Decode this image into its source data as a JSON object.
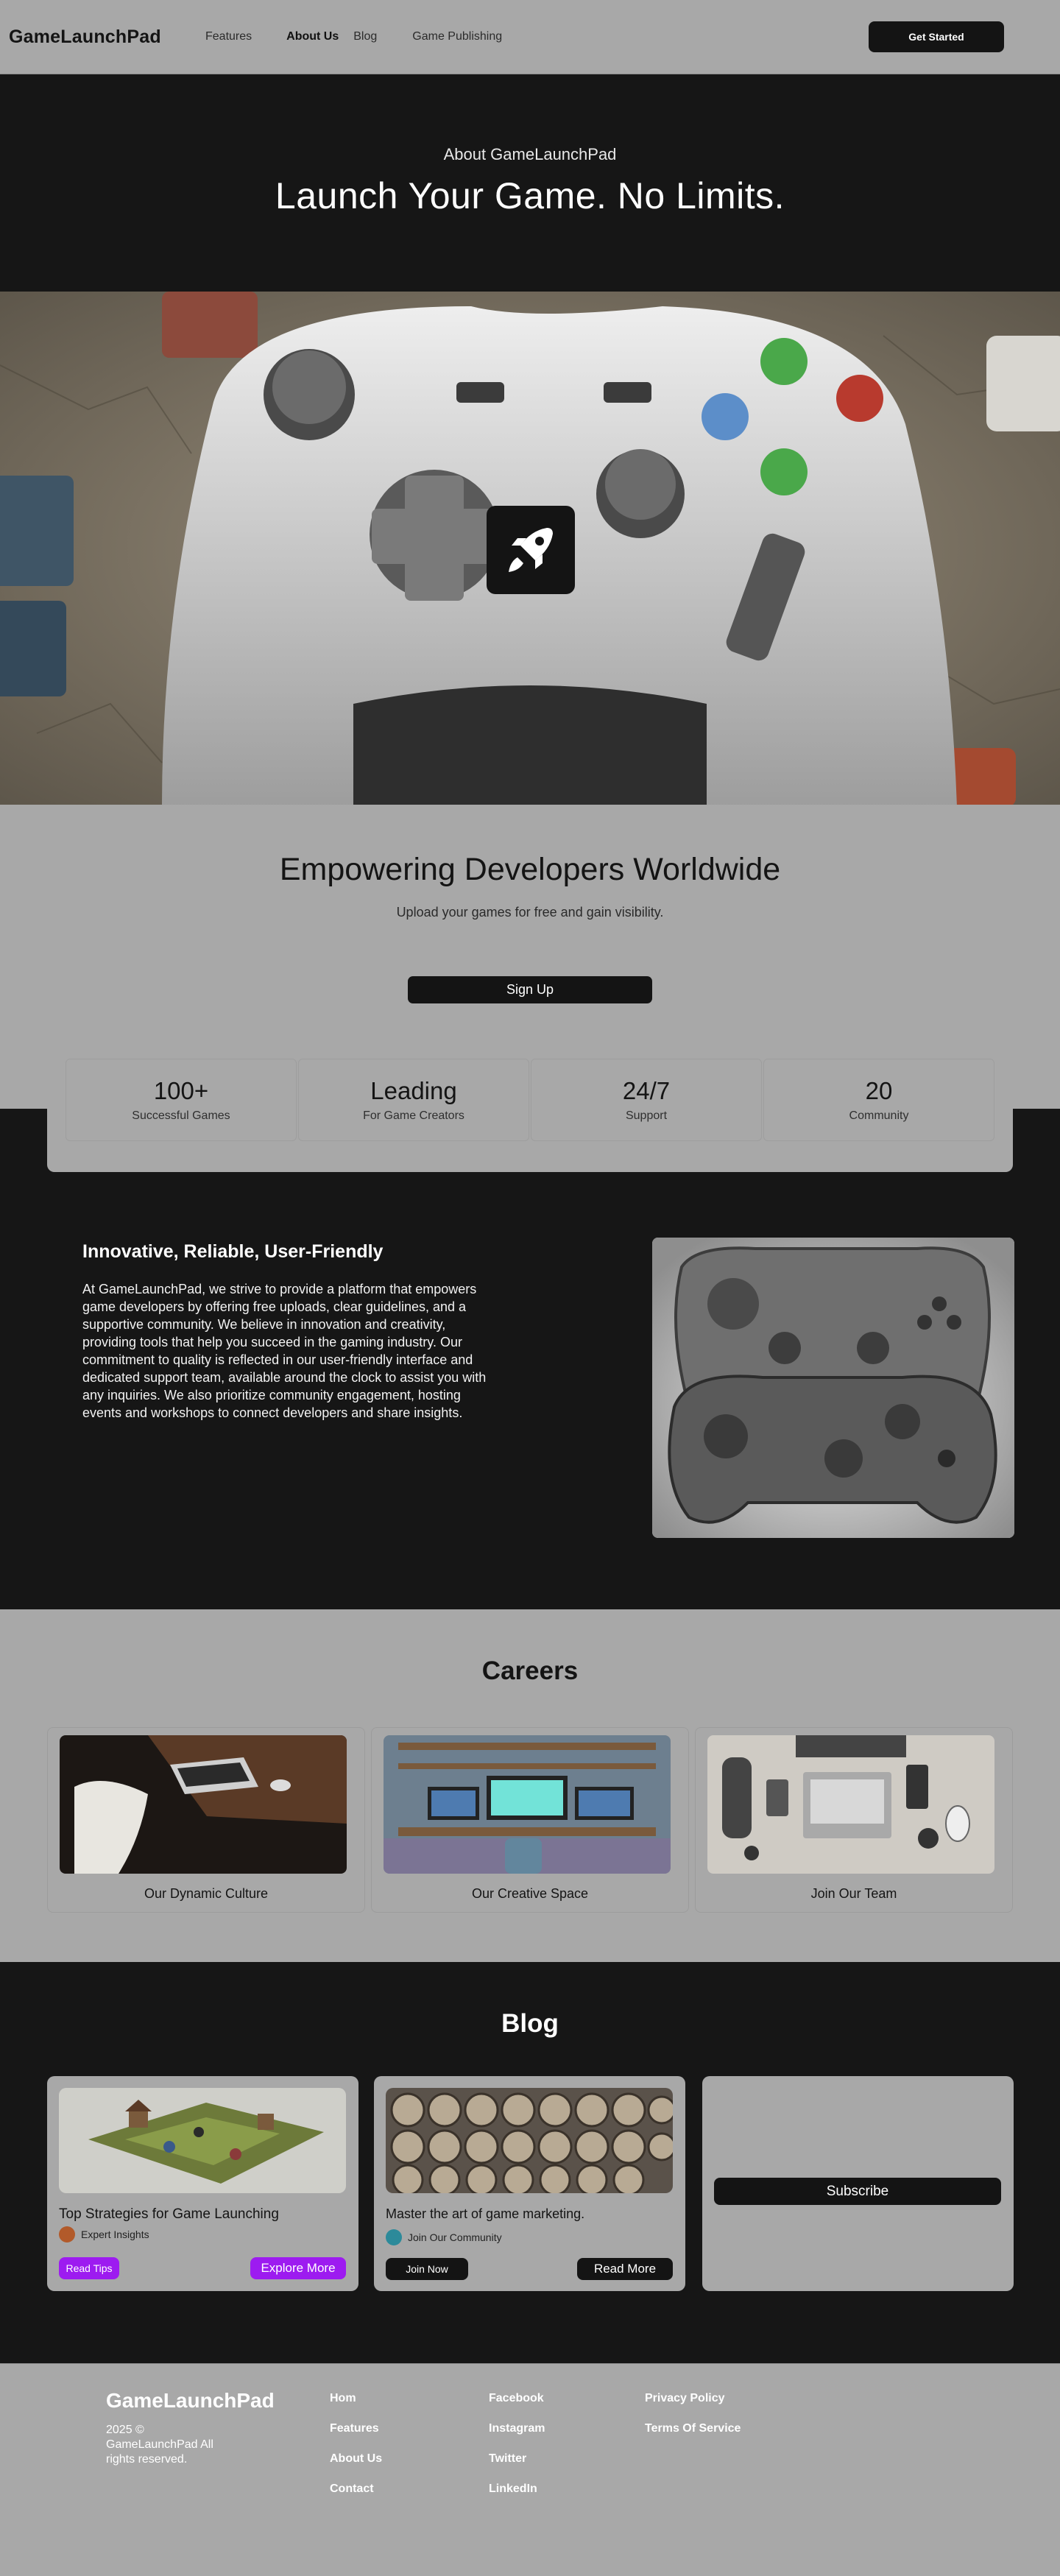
{
  "nav": {
    "logo": "GameLaunchPad",
    "links": [
      "Features",
      "About Us",
      "Blog",
      "Game Publishing"
    ],
    "cta": "Get Started"
  },
  "hero": {
    "kicker": "About GameLaunchPad",
    "title": "Launch Your Game. No Limits."
  },
  "empower": {
    "title": "Empowering Developers Worldwide",
    "subtitle": "Upload your games for free and gain visibility.",
    "button": "Sign Up"
  },
  "stats": [
    {
      "value": "100+",
      "label": "Successful Games"
    },
    {
      "value": "Leading",
      "label": "For Game Creators"
    },
    {
      "value": "24/7",
      "label": "Support"
    },
    {
      "value": "20",
      "label": "Community"
    }
  ],
  "about": {
    "heading": "Innovative, Reliable, User-Friendly",
    "body": "At GameLaunchPad, we strive to provide a platform that empowers game developers by offering free uploads, clear guidelines, and a supportive community. We believe in innovation and creativity, providing tools that help you succeed in the gaming industry. Our commitment to quality is reflected in our user-friendly interface and dedicated support team, available around the clock to assist you with any inquiries. We also prioritize community engagement, hosting events and workshops to connect developers and share insights."
  },
  "careers": {
    "title": "Careers",
    "cards": [
      "Our Dynamic Culture",
      "Our Creative Space",
      "Join Our Team"
    ]
  },
  "blog": {
    "title": "Blog",
    "cards": [
      {
        "title": "Top Strategies for Game Launching",
        "author": "Expert Insights",
        "tag": "Read Tips",
        "cta": "Explore More"
      },
      {
        "title": "Master the art of game marketing.",
        "author": "Join Our Community",
        "tag": "Join Now",
        "cta": "Read More"
      }
    ],
    "subscribe": "Subscribe"
  },
  "footer": {
    "logo": "GameLaunchPad",
    "copyright": "2025 © GameLaunchPad All rights reserved.",
    "col1": [
      "Hom",
      "Features",
      "About Us",
      "Contact"
    ],
    "col2": [
      "Facebook",
      "Instagram",
      "Twitter",
      "LinkedIn"
    ],
    "col3": [
      "Privacy Policy",
      "Terms Of Service"
    ]
  },
  "colors": {
    "dark": "#161616",
    "gray": "#a8a8a8",
    "accent_purple": "#9d1bf0"
  }
}
